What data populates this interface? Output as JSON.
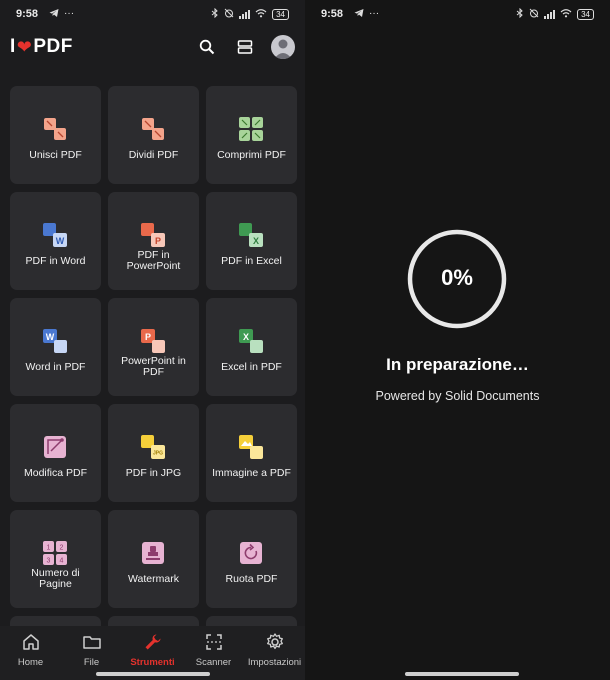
{
  "left": {
    "status": {
      "time": "9:58",
      "battery": "34"
    },
    "appbar": {
      "logo_letter": "I",
      "logo_heart": "❤",
      "logo_text": "PDF"
    },
    "tools": [
      {
        "label": "Unisci PDF",
        "icon": "merge-icon"
      },
      {
        "label": "Dividi PDF",
        "icon": "split-icon"
      },
      {
        "label": "Comprimi PDF",
        "icon": "compress-icon"
      },
      {
        "label": "PDF in Word",
        "icon": "pdf-to-word-icon"
      },
      {
        "label": "PDF in PowerPoint",
        "icon": "pdf-to-powerpoint-icon"
      },
      {
        "label": "PDF in Excel",
        "icon": "pdf-to-excel-icon"
      },
      {
        "label": "Word in PDF",
        "icon": "word-to-pdf-icon"
      },
      {
        "label": "PowerPoint in PDF",
        "icon": "powerpoint-to-pdf-icon"
      },
      {
        "label": "Excel in PDF",
        "icon": "excel-to-pdf-icon"
      },
      {
        "label": "Modifica PDF",
        "icon": "edit-pdf-icon"
      },
      {
        "label": "PDF in JPG",
        "icon": "pdf-to-jpg-icon"
      },
      {
        "label": "Immagine a PDF",
        "icon": "image-to-pdf-icon"
      },
      {
        "label": "Numero di Pagine",
        "icon": "page-numbers-icon"
      },
      {
        "label": "Watermark",
        "icon": "watermark-icon"
      },
      {
        "label": "Ruota PDF",
        "icon": "rotate-pdf-icon"
      }
    ],
    "nav": {
      "home": "Home",
      "file": "File",
      "tools": "Strumenti",
      "scanner": "Scanner",
      "settings": "Impostazioni"
    },
    "icon_letters": {
      "word": "W",
      "powerpoint": "P",
      "excel": "X",
      "jpg": "JPG"
    }
  },
  "right": {
    "status": {
      "time": "9:58",
      "battery": "34"
    },
    "progress": {
      "value": 0,
      "label": "0%"
    },
    "title": "In preparazione…",
    "subtitle": "Powered by Solid Documents"
  },
  "colors": {
    "accent": "#e5322d",
    "background": "#1c1c1e",
    "tile": "#2c2c2f"
  }
}
